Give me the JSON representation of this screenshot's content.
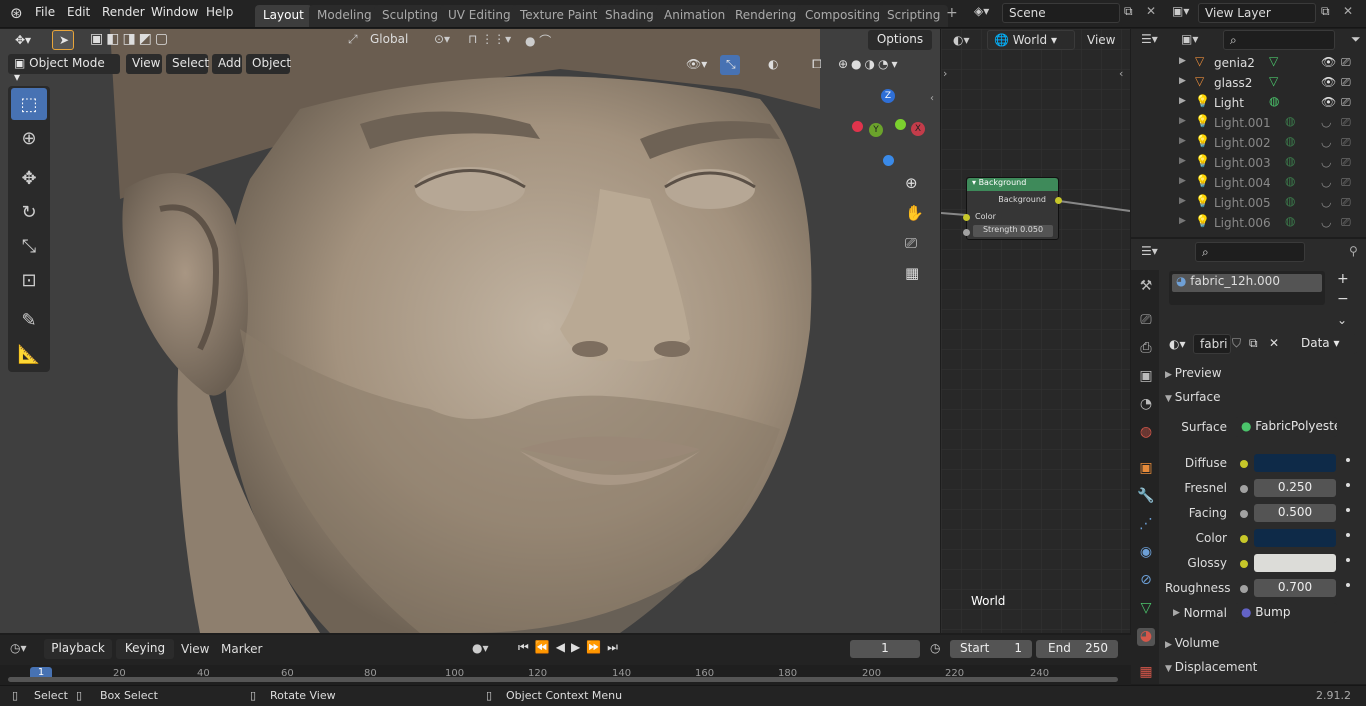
{
  "topbar": {
    "menus": [
      "File",
      "Edit",
      "Render",
      "Window",
      "Help"
    ],
    "workspace_tabs": [
      "Layout",
      "Modeling",
      "Sculpting",
      "UV Editing",
      "Texture Paint",
      "Shading",
      "Animation",
      "Rendering",
      "Compositing",
      "Scripting"
    ],
    "active_tab": "Layout",
    "scene_label": "Scene",
    "view_layer_label": "View Layer"
  },
  "viewport_header": {
    "orientation": "Global",
    "options": "Options",
    "mode": "Object Mode",
    "menus": [
      "View",
      "Select",
      "Add",
      "Object"
    ]
  },
  "gizmo": {
    "z": "Z",
    "y": "Y",
    "x": "X"
  },
  "node_editor": {
    "world_select": "World",
    "view_menu": "View",
    "node_title": "Background",
    "node_output": "Background",
    "node_input_color": "Color",
    "node_strength_label": "Strength",
    "node_strength_value": "0.050",
    "footer_label": "World"
  },
  "outliner": {
    "items": [
      {
        "name": "genia2",
        "dim": false
      },
      {
        "name": "glass2",
        "dim": false
      },
      {
        "name": "Light",
        "dim": false
      },
      {
        "name": "Light.001",
        "dim": true
      },
      {
        "name": "Light.002",
        "dim": true
      },
      {
        "name": "Light.003",
        "dim": true
      },
      {
        "name": "Light.004",
        "dim": true
      },
      {
        "name": "Light.005",
        "dim": true
      },
      {
        "name": "Light.006",
        "dim": true
      }
    ]
  },
  "properties": {
    "material_slot": "fabric_12h.000",
    "material_name": "fabri",
    "link_mode": "Data",
    "panels": {
      "preview": "Preview",
      "surface": "Surface",
      "volume": "Volume",
      "displacement": "Displacement"
    },
    "surface_shader_label": "Surface",
    "surface_shader_value": "FabricPolyeste...",
    "diffuse_label": "Diffuse",
    "fresnel_label": "Fresnel",
    "fresnel_value": "0.250",
    "facing_label": "Facing",
    "facing_value": "0.500",
    "color_label": "Color",
    "glossy_label": "Glossy",
    "roughness_label": "Roughness",
    "roughness_value": "0.700",
    "normal_label": "Normal",
    "normal_value": "Bump",
    "colors": {
      "diffuse": "#0e2a48",
      "color": "#0e2a48",
      "glossy": "#dcdcd8"
    }
  },
  "timeline": {
    "menus": [
      "Playback",
      "Keying",
      "View",
      "Marker"
    ],
    "current_frame": "1",
    "start_label": "Start",
    "start_value": "1",
    "end_label": "End",
    "end_value": "250",
    "ruler": [
      "1",
      "20",
      "40",
      "60",
      "80",
      "100",
      "120",
      "140",
      "160",
      "180",
      "200",
      "220",
      "240"
    ]
  },
  "statusbar": {
    "select": "Select",
    "box_select": "Box Select",
    "rotate_view": "Rotate View",
    "context_menu": "Object Context Menu",
    "version": "2.91.2"
  }
}
